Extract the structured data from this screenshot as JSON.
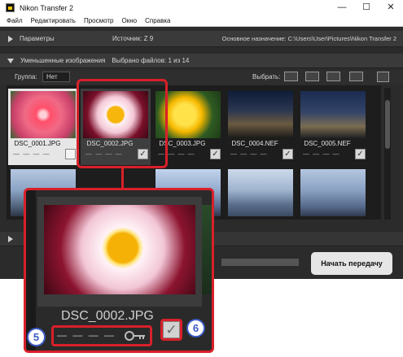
{
  "window": {
    "title": "Nikon Transfer 2",
    "controls": {
      "minimize": "—",
      "maximize": "☐",
      "close": "✕"
    }
  },
  "menu": [
    "Файл",
    "Редактировать",
    "Просмотр",
    "Окно",
    "Справка"
  ],
  "params": {
    "label": "Параметры",
    "source": "Источник: Z 9",
    "destination": "Основное назначение: C:\\Users\\User\\Pictures\\Nikon Transfer 2"
  },
  "thumbnails_header": {
    "label": "Уменьшенные изображения",
    "selected": "Выбрано файлов: 1 из 14"
  },
  "toolbar": {
    "group_label": "Группа:",
    "group_value": "Нет",
    "select_label": "Выбрать:"
  },
  "files": [
    {
      "name": "DSC_0001.JPG",
      "checked": false
    },
    {
      "name": "DSC_0002.JPG",
      "checked": true
    },
    {
      "name": "DSC_0003.JPG",
      "checked": true
    },
    {
      "name": "DSC_0004.NEF",
      "checked": true
    },
    {
      "name": "DSC_0005.NEF",
      "checked": true
    }
  ],
  "zoom": {
    "name": "DSC_0002.JPG",
    "dashes": "— — — —"
  },
  "dashes": "— — — —",
  "start_button": "Начать передачу",
  "callouts": [
    "5",
    "6"
  ]
}
